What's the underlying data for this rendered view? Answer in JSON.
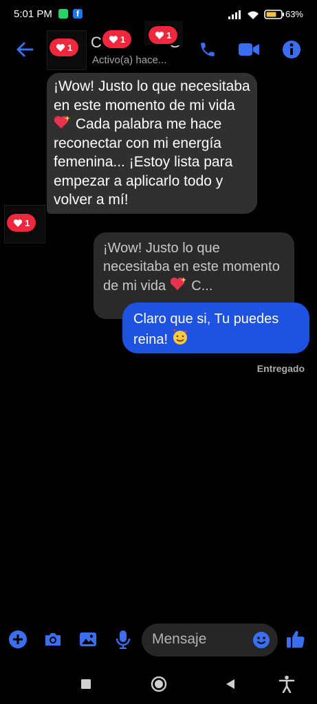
{
  "status_bar": {
    "time": "5:01 PM",
    "battery": "63%"
  },
  "header": {
    "contact_name": "C                G",
    "contact_status": "Activo(a) hace..."
  },
  "reactions": [
    {
      "count": "1"
    },
    {
      "count": "1"
    },
    {
      "count": "1"
    },
    {
      "count": "1"
    }
  ],
  "messages": {
    "incoming_text": "¡Wow! Justo lo que necesitaba en este momento de mi vida",
    "incoming_text_2": " Cada palabra me hace reconectar con mi energía femenina... ¡Estoy lista para empezar a aplicarlo todo y volver a mí!",
    "quoted_text": "¡Wow! Justo lo que necesitaba en este momento de mi vida",
    "quoted_more": " C...",
    "outgoing_text": "Claro que si, Tu puedes reina!",
    "delivered_label": "Entregado"
  },
  "composer": {
    "placeholder": "Mensaje"
  },
  "colors": {
    "accent": "#1d53e0",
    "icon_blue": "#3a6ff2",
    "reaction_red": "#f0283d"
  },
  "icons": [
    "back-arrow-icon",
    "phone-icon",
    "video-icon",
    "info-icon",
    "plus-icon",
    "camera-icon",
    "gallery-icon",
    "microphone-icon",
    "emoji-icon",
    "thumbs-up-icon",
    "sparkling-heart-icon",
    "smiling-hearts-face-icon"
  ]
}
